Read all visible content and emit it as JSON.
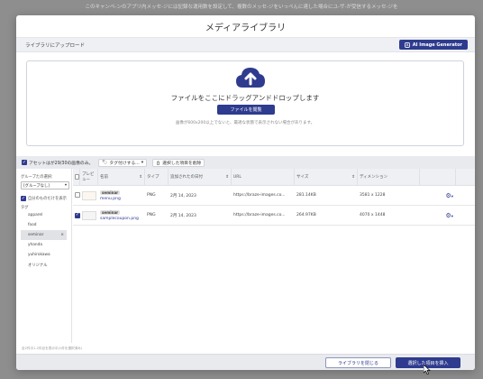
{
  "backdrop_text": "このキャンペ-ンのアプリ内メッセ-ジには記録な運用数を設定して、複数のメッセ-ジをいっぺんに達した場合にユ-ザ-が受信するメッセ-ジを",
  "modal": {
    "title": "メディアライブラリ",
    "upload_label": "ライブラリにアップロード",
    "ai_button": "AI Image Generator",
    "drop_title": "ファイルをここにドラッグアンドドロップします",
    "file_button": "ファイルを閲覧",
    "drop_note": "画像が600x200以上でないと、最適な状態で表示されない場合があります。"
  },
  "toolbar": {
    "assets_label": "アセットはが29/30の画像のみ。",
    "tag_button": "タグ付けする...",
    "delete_button": "選択した項目を削除"
  },
  "sidebar": {
    "group_label": "グループたの選択:",
    "group_value": "[グループなし]",
    "own_files_label": "自分のものだけを表示",
    "tags_label": "タグ",
    "tags": [
      "apparel",
      "food",
      "seminar",
      "yhanda",
      "yuhirokawa",
      "オリジナル"
    ],
    "active_tag": "seminar",
    "remove_symbol": "×"
  },
  "table": {
    "headers": [
      "",
      "プレビュー",
      "名前",
      "タイプ",
      "追加されたの日付",
      "URL",
      "サイズ",
      "ディメンション",
      ""
    ],
    "rows": [
      {
        "checked": false,
        "tag": "seminar",
        "name": "menu.png",
        "type": "PNG",
        "date": "2月 14, 2023",
        "url": "https://braze-images.co...",
        "size": "281.14KB",
        "dimension": "3581 x 1228"
      },
      {
        "checked": true,
        "tag": "seminar",
        "name": "samplecoupon.png",
        "type": "PNG",
        "date": "2月 14, 2023",
        "url": "https://braze-images.co...",
        "size": "264.97KB",
        "dimension": "4070 x 1448"
      }
    ]
  },
  "status_text": "全2件中1-2件目を表示中(1件を選択済み)",
  "footer": {
    "close_button": "ライブラリを閉じる",
    "insert_button": "選択した項目を挿入"
  },
  "colors": {
    "accent": "#2e3b8e",
    "overlay": "#8e8e8e"
  },
  "icons": [
    "cloud-upload-icon",
    "tag-icon",
    "trash-icon",
    "gear-icon",
    "sort-icon",
    "chevron-down-icon"
  ]
}
